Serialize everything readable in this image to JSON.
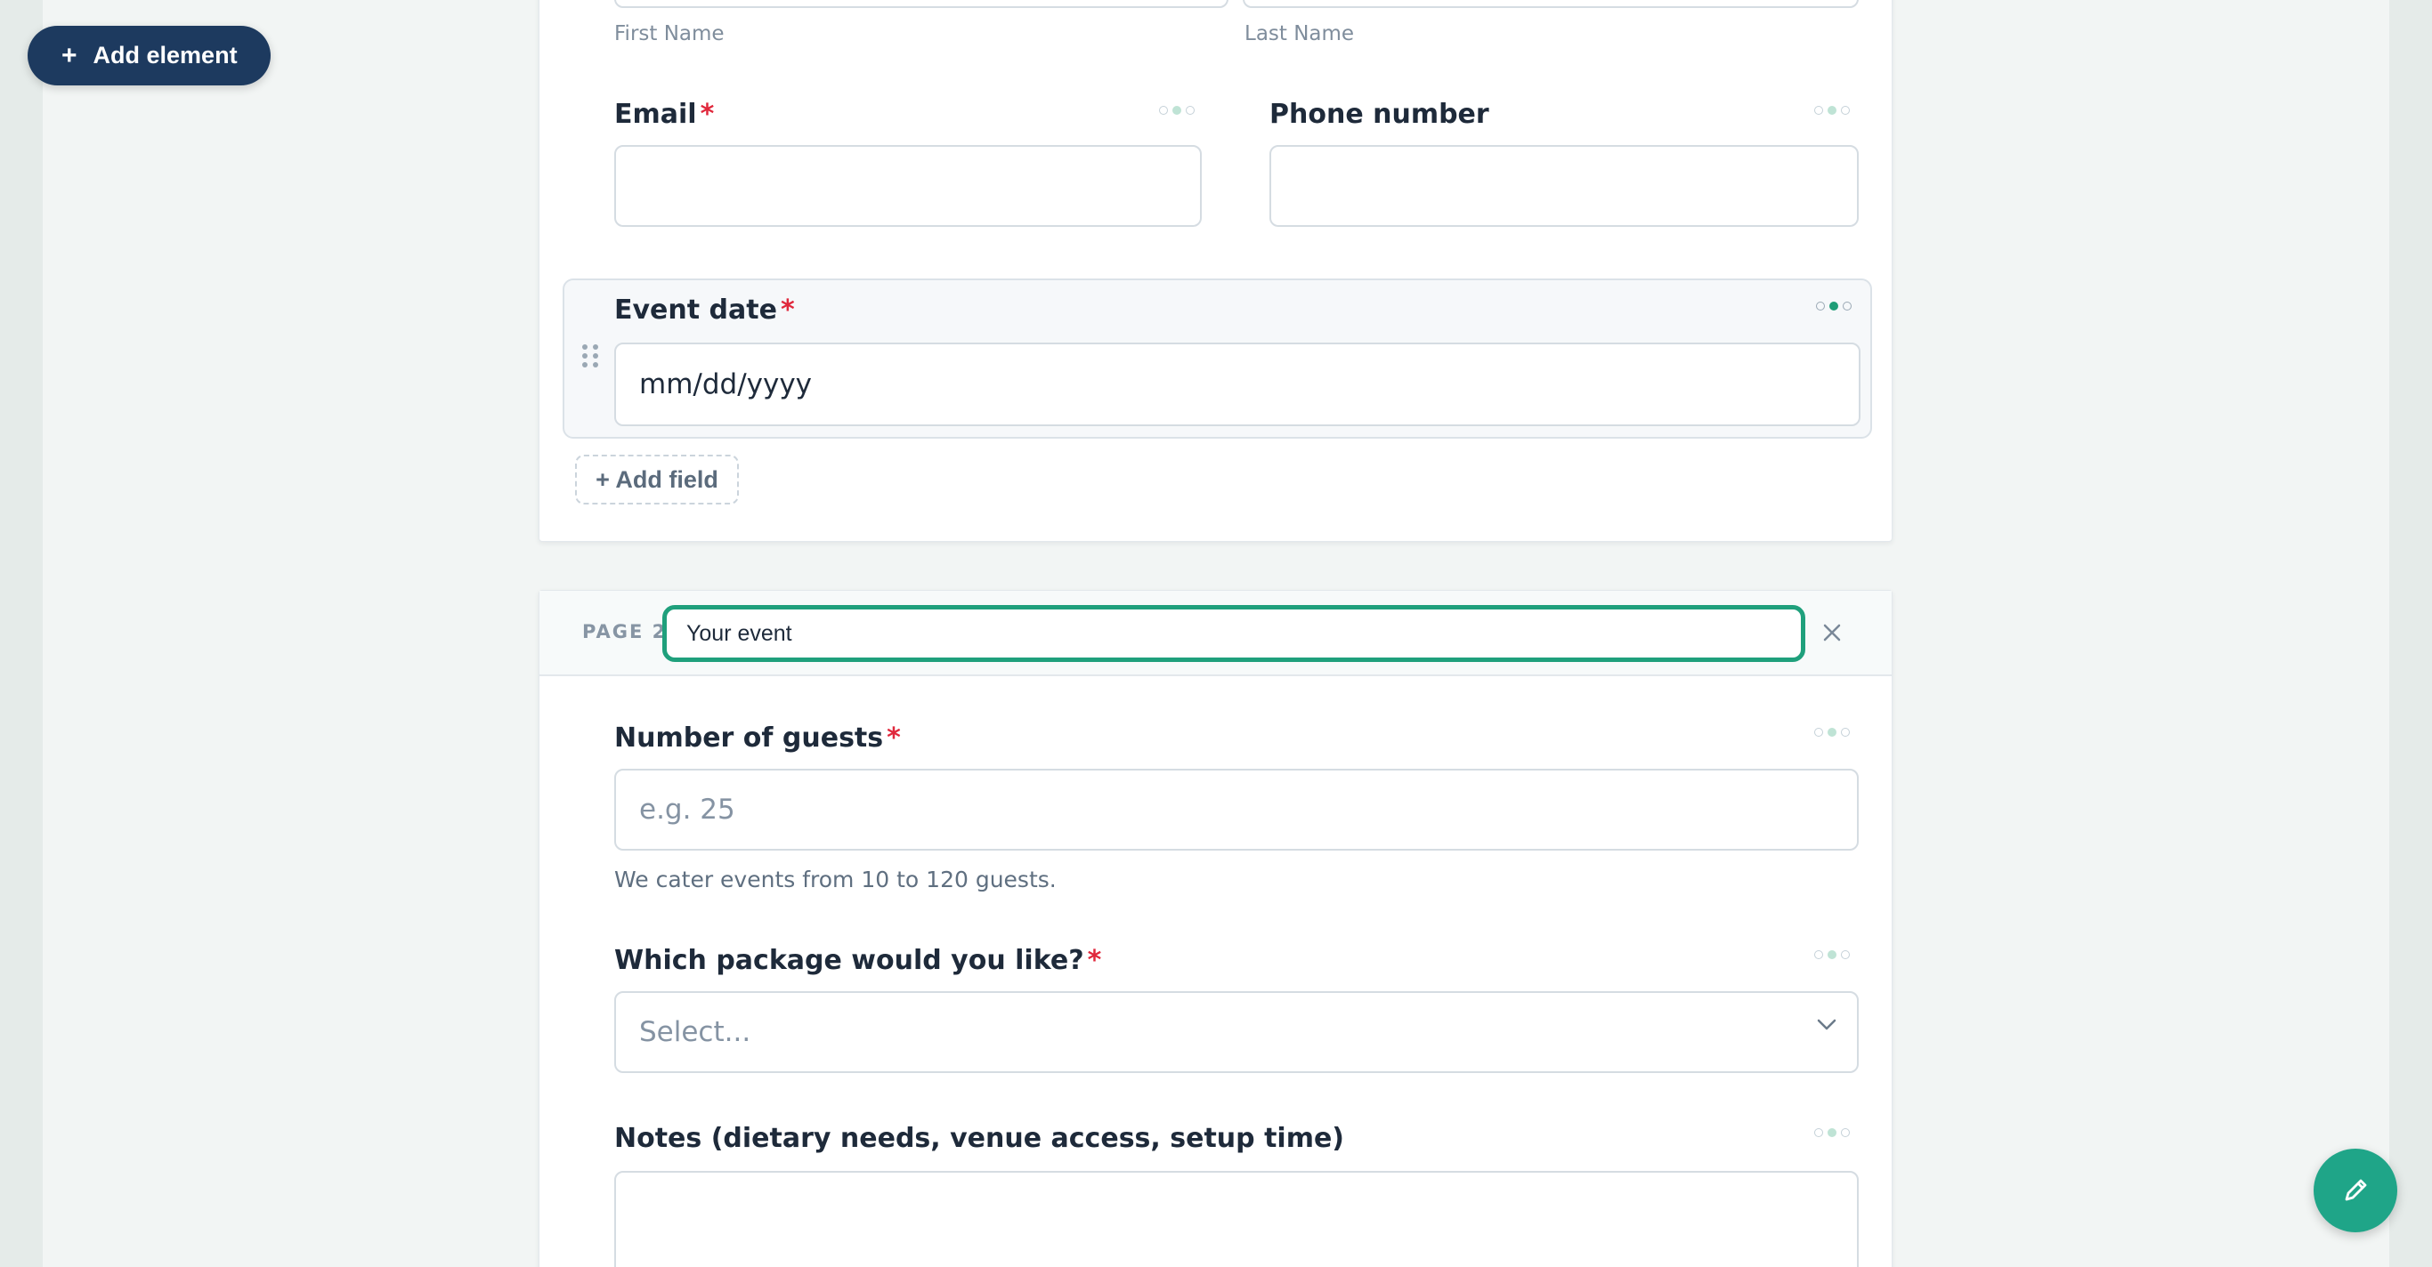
{
  "toolbar": {
    "add_element_label": "Add element"
  },
  "page1": {
    "name_fields": {
      "first_name_label": "First Name",
      "last_name_label": "Last Name"
    },
    "email": {
      "label": "Email",
      "required": "*",
      "value": ""
    },
    "phone": {
      "label": "Phone number",
      "value": ""
    },
    "event_date": {
      "label": "Event date",
      "required": "*",
      "placeholder": "mm/dd/yyyy"
    },
    "add_field_label": "+ Add field"
  },
  "page2": {
    "tag": "PAGE 2",
    "title_value": "Your event",
    "guests": {
      "label": "Number of guests",
      "required": "*",
      "placeholder": "e.g. 25",
      "helper": "We cater events from 10 to 120 guests."
    },
    "package": {
      "label": "Which package would you like?",
      "required": "*",
      "selected": "Select..."
    },
    "notes": {
      "label": "Notes (dietary needs, venue access, setup time)",
      "value": ""
    }
  },
  "icons": {
    "plus": "plus-icon",
    "drag": "drag-handle-icon",
    "close": "close-icon",
    "chevron": "chevron-down-icon",
    "edit": "pencil-icon",
    "options": "options-dots-icon"
  },
  "colors": {
    "accent": "#1fa07c",
    "brand_navy": "#1d3a5f",
    "required": "#e0283c",
    "fab": "#1fa588"
  }
}
